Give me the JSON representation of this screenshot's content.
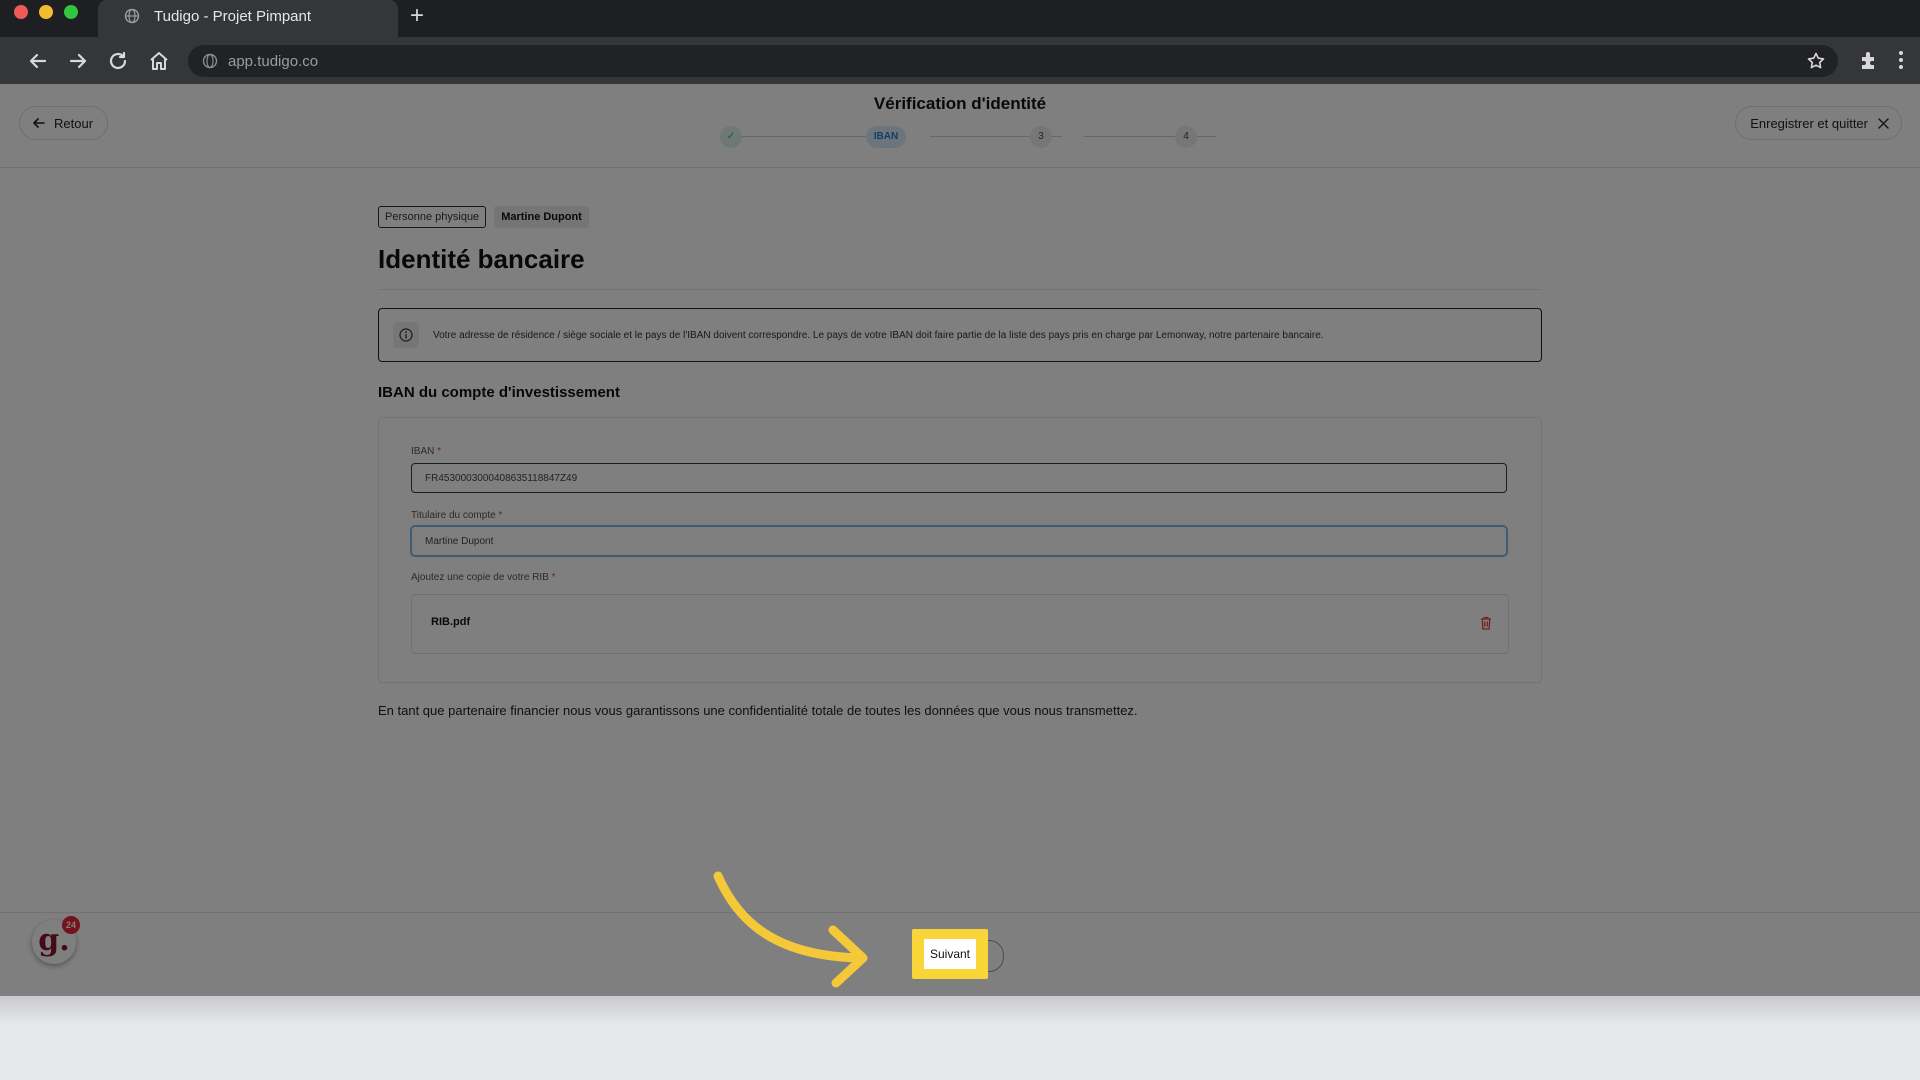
{
  "browser": {
    "tab_title": "Tudigo - Projet Pimpant",
    "new_tab_label": "+",
    "url": "app.tudigo.co"
  },
  "header": {
    "back_label": "Retour",
    "title": "Vérification d'identité",
    "save_quit_label": "Enregistrer et quitter",
    "steps": [
      {
        "label": "✓",
        "state": "done"
      },
      {
        "label": "IBAN",
        "state": "active"
      },
      {
        "label": "3",
        "state": "pending"
      },
      {
        "label": "4",
        "state": "pending"
      }
    ]
  },
  "main": {
    "chips": [
      "Personne physique",
      "Martine Dupont"
    ],
    "title": "Identité bancaire",
    "info_text": "Votre adresse de résidence / siège sociale et le pays de l'IBAN doivent correspondre. Le pays de votre IBAN doit faire partie de la liste des pays pris en charge par Lemonway, notre partenaire bancaire.",
    "section_title": "IBAN du compte d'investissement",
    "form": {
      "iban_label": "IBAN",
      "iban_value": "FR4530003000408635118847Z49",
      "holder_label": "Titulaire du compte",
      "holder_value": "Martine Dupont",
      "rib_label": "Ajoutez une copie de votre RIB",
      "required_mark": "*",
      "file_name": "RIB.pdf"
    },
    "footnote": "En tant que partenaire financier nous vous garantissons une confidentialité totale de toutes les données que vous nous transmettez."
  },
  "footer": {
    "next_label": "Suivant",
    "widget_letter": "g.",
    "widget_badge": "24"
  },
  "colors": {
    "highlight": "#f8d63a",
    "arrow": "#f5c83a",
    "required": "#e4443a",
    "delete": "#e4443a",
    "brand": "#8b1530"
  },
  "icons": [
    "globe-icon",
    "back-icon",
    "forward-icon",
    "reload-icon",
    "home-icon",
    "star-icon",
    "extensions-icon",
    "menu-icon",
    "arrow-left-icon",
    "close-icon",
    "info-icon",
    "trash-icon",
    "check-icon"
  ]
}
